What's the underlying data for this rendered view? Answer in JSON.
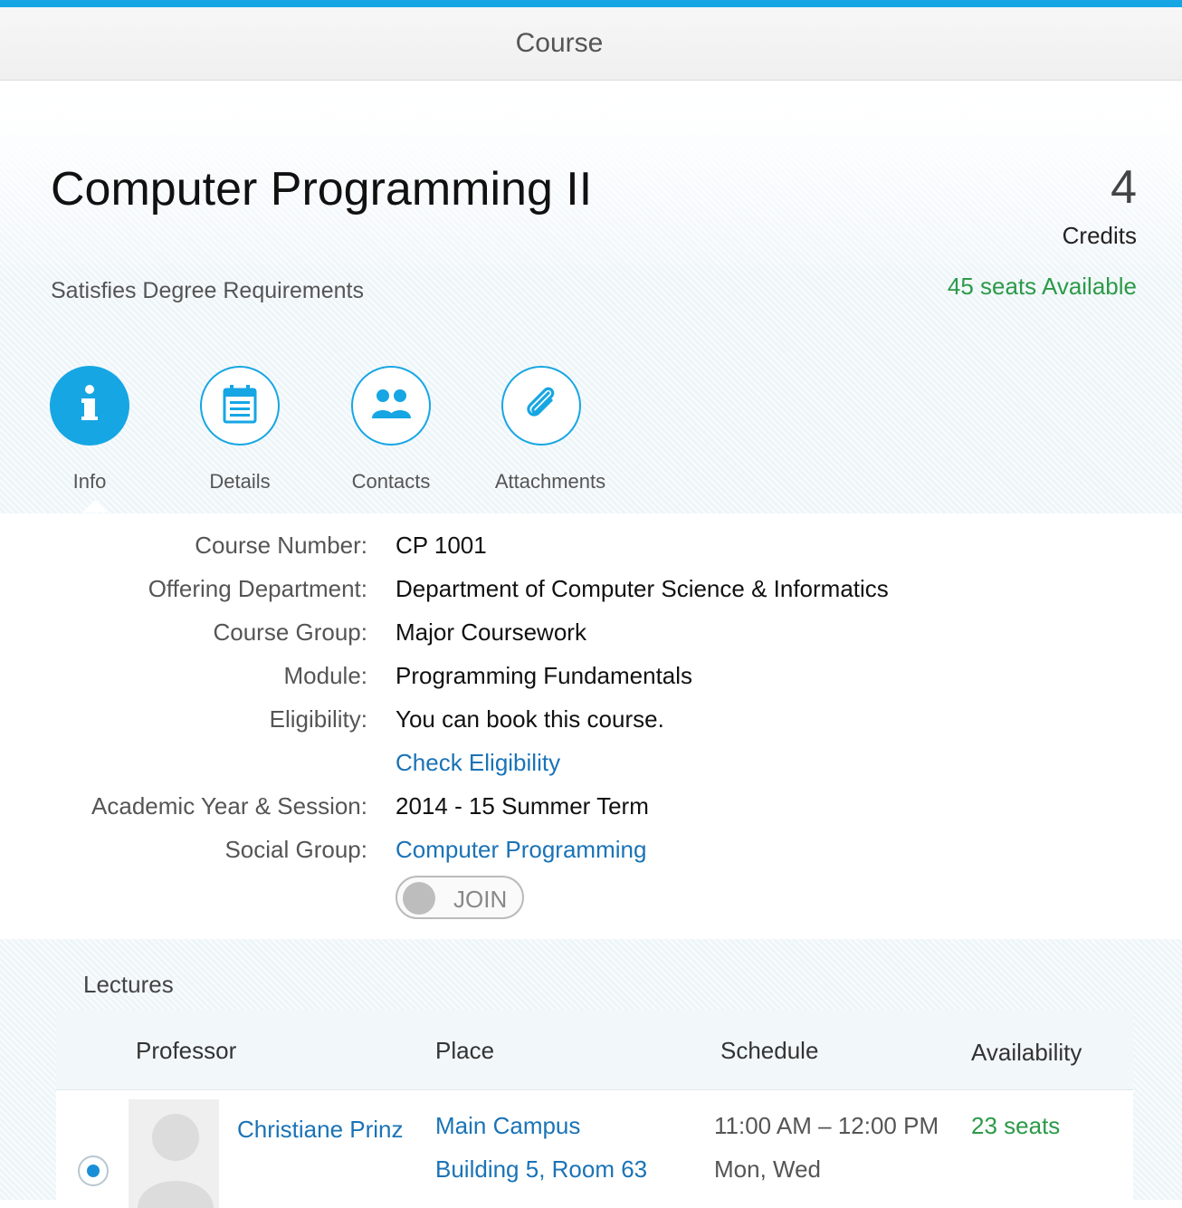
{
  "header": {
    "title": "Course"
  },
  "course": {
    "title": "Computer Programming II",
    "subtitle": "Satisfies Degree Requirements",
    "credits_value": "4",
    "credits_label": "Credits",
    "seats_available": "45 seats Available"
  },
  "tabs": [
    {
      "label": "Info",
      "icon": "info-icon",
      "active": true
    },
    {
      "label": "Details",
      "icon": "calendar-icon",
      "active": false
    },
    {
      "label": "Contacts",
      "icon": "people-icon",
      "active": false
    },
    {
      "label": "Attachments",
      "icon": "paperclip-icon",
      "active": false
    }
  ],
  "info": {
    "course_number_label": "Course Number:",
    "course_number": "CP 1001",
    "department_label": "Offering Department:",
    "department": "Department of Computer Science & Informatics",
    "group_label": "Course Group:",
    "group": "Major Coursework",
    "module_label": "Module:",
    "module": "Programming Fundamentals",
    "eligibility_label": "Eligibility:",
    "eligibility": "You can book this course.",
    "check_eligibility": "Check Eligibility",
    "session_label": "Academic Year & Session:",
    "session": "2014 - 15 Summer Term",
    "social_label": "Social Group:",
    "social_group": "Computer Programming",
    "join_label": "JOIN"
  },
  "lectures": {
    "title": "Lectures",
    "columns": [
      "Professor",
      "Place",
      "Schedule",
      "Availability"
    ],
    "rows": [
      {
        "professor": "Christiane Prinz",
        "place_line1": "Main Campus",
        "place_line2": "Building 5, Room 63",
        "time": "11:00 AM – 12:00 PM",
        "days": "Mon, Wed",
        "availability": "23 seats"
      }
    ]
  },
  "colors": {
    "accent": "#16a6e3",
    "link": "#1a73b6",
    "success": "#2b9a48"
  }
}
